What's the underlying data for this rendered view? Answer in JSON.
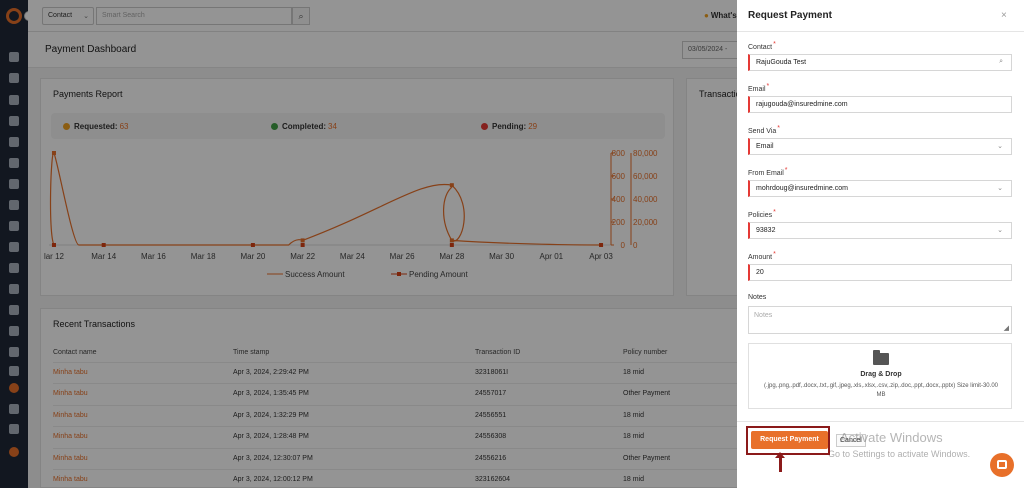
{
  "topbar": {
    "contact_select": "Contact",
    "search_placeholder": "Smart Search",
    "whats_new": "What's"
  },
  "page": {
    "title": "Payment Dashboard",
    "date_range": "03/05/2024 -"
  },
  "report": {
    "title": "Payments Report",
    "statuses": [
      {
        "label": "Requested:",
        "count": "63",
        "color": "#f0a020"
      },
      {
        "label": "Completed:",
        "count": "34",
        "color": "#43a047"
      },
      {
        "label": "Pending:",
        "count": "29",
        "color": "#e53935"
      }
    ]
  },
  "chart_data": {
    "type": "line",
    "x_ticks": [
      "lar 12",
      "Mar 14",
      "Mar 16",
      "Mar 18",
      "Mar 20",
      "Mar 22",
      "Mar 24",
      "Mar 26",
      "Mar 28",
      "Mar 30",
      "Apr 01",
      "Apr 03"
    ],
    "y_left_ticks": [
      "0",
      "200",
      "400",
      "600",
      "800"
    ],
    "y_right_ticks": [
      "0",
      "20,000",
      "40,000",
      "60,000",
      "80,000"
    ],
    "y_left_range": [
      0,
      800
    ],
    "series": [
      {
        "name": "Success Amount",
        "color": "#e8702a",
        "points": [
          [
            "Mar 12",
            0
          ],
          [
            "Mar 12",
            800
          ],
          [
            "Mar 13",
            0
          ],
          [
            "Mar 22",
            40
          ],
          [
            "Mar 28",
            520
          ],
          [
            "Mar 28",
            40
          ],
          [
            "Apr 03",
            0
          ]
        ]
      },
      {
        "name": "Pending Amount",
        "color": "#d84315",
        "points": [
          [
            "Mar 12",
            0
          ],
          [
            "Mar 14",
            0
          ],
          [
            "Mar 20",
            0
          ],
          [
            "Mar 22",
            0
          ],
          [
            "Mar 28",
            0
          ],
          [
            "Apr 03",
            0
          ]
        ]
      }
    ],
    "legend_position": "bottom",
    "grid": false
  },
  "transactions": {
    "card_title": "Transactio",
    "recent_title": "Recent Transactions",
    "columns": [
      "Contact name",
      "Time stamp",
      "Transaction ID",
      "Policy number"
    ],
    "rows": [
      [
        "Minha tabu",
        "Apr 3, 2024, 2:29:42 PM",
        "32318061I",
        "18 mid"
      ],
      [
        "Minha tabu",
        "Apr 3, 2024, 1:35:45 PM",
        "24557017",
        "Other Payment"
      ],
      [
        "Minha tabu",
        "Apr 3, 2024, 1:32:29 PM",
        "24556551",
        "18 mid"
      ],
      [
        "Minha tabu",
        "Apr 3, 2024, 1:28:48 PM",
        "24556308",
        "18 mid"
      ],
      [
        "Minha tabu",
        "Apr 3, 2024, 12:30:07 PM",
        "24556216",
        "Other Payment"
      ],
      [
        "Minha tabu",
        "Apr 3, 2024, 12:00:12 PM",
        "323162604",
        "18 mid"
      ]
    ]
  },
  "drawer": {
    "title": "Request Payment",
    "close": "×",
    "contact_label": "Contact",
    "contact_value": "RajuGouda Test",
    "email_label": "Email",
    "email_value": "rajugouda@insuredmine.com",
    "send_via_label": "Send Via",
    "send_via_value": "Email",
    "from_email_label": "From Email",
    "from_email_value": "mohrdoug@insuredmine.com",
    "policies_label": "Policies",
    "policies_value": "93832",
    "amount_label": "Amount",
    "amount_value": "20",
    "notes_label": "Notes",
    "notes_placeholder": "Notes",
    "drop_title": "Drag & Drop",
    "drop_hint": "(.jpg,.png,.pdf,.docx,.txt,.gif,.jpeg,.xls,.xlsx,.csv,.zip,.doc,.ppt,.docx,.pptx) Size limit-30.00 MB",
    "submit_label": "Request Payment",
    "cancel_label": "Cancel"
  },
  "watermark": {
    "line1": "Activate Windows",
    "line2": "Go to Settings to activate Windows."
  },
  "colors": {
    "accent": "#e8702a",
    "required": "#e53935",
    "highlight": "#8b1a1a"
  }
}
